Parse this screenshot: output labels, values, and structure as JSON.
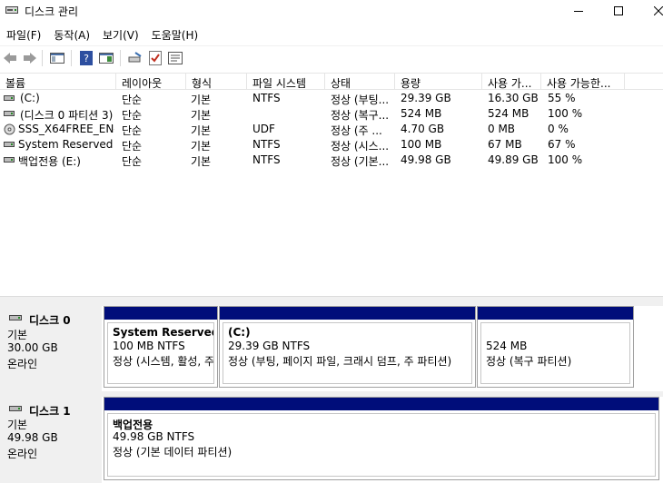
{
  "window": {
    "title": "디스크 관리"
  },
  "menu": [
    "파일(F)",
    "동작(A)",
    "보기(V)",
    "도움말(H)"
  ],
  "columns": [
    "볼륨",
    "레이아웃",
    "형식",
    "파일 시스템",
    "상태",
    "용량",
    "사용 가...",
    "사용 가능한..."
  ],
  "volumes": [
    {
      "name": "(C:)",
      "layout": "단순",
      "type": "기본",
      "fs": "NTFS",
      "status": "정상 (부팅...",
      "capacity": "29.39 GB",
      "free": "16.30 GB",
      "pct": "55 %",
      "icon": "drive-icon"
    },
    {
      "name": "(디스크 0 파티션 3)",
      "layout": "단순",
      "type": "기본",
      "fs": "",
      "status": "정상 (복구...",
      "capacity": "524 MB",
      "free": "524 MB",
      "pct": "100 %",
      "icon": "drive-icon"
    },
    {
      "name": "SSS_X64FREE_EN-...",
      "layout": "단순",
      "type": "기본",
      "fs": "UDF",
      "status": "정상 (주 ...",
      "capacity": "4.70 GB",
      "free": "0 MB",
      "pct": "0 %",
      "icon": "cd-drive-icon"
    },
    {
      "name": "System Reserved",
      "layout": "단순",
      "type": "기본",
      "fs": "NTFS",
      "status": "정상 (시스...",
      "capacity": "100 MB",
      "free": "67 MB",
      "pct": "67 %",
      "icon": "drive-icon"
    },
    {
      "name": "백업전용 (E:)",
      "layout": "단순",
      "type": "기본",
      "fs": "NTFS",
      "status": "정상 (기본...",
      "capacity": "49.98 GB",
      "free": "49.89 GB",
      "pct": "100 %",
      "icon": "drive-icon"
    }
  ],
  "disks": [
    {
      "name": "디스크 0",
      "type": "기본",
      "size": "30.00 GB",
      "state": "온라인",
      "partitions": [
        {
          "title": "System Reserved",
          "size": "100 MB NTFS",
          "status": "정상 (시스템, 활성, 주 파티션)"
        },
        {
          "title": "(C:)",
          "size": "29.39 GB NTFS",
          "status": "정상 (부팅, 페이지 파일, 크래시 덤프, 주 파티션)"
        },
        {
          "title": "",
          "size": "524 MB",
          "status": "정상 (복구 파티션)"
        }
      ]
    },
    {
      "name": "디스크 1",
      "type": "기본",
      "size": "49.98 GB",
      "state": "온라인",
      "partitions": [
        {
          "title": "백업전용",
          "size": "49.98 GB NTFS",
          "status": "정상 (기본 데이터 파티션)"
        }
      ]
    }
  ],
  "colors": {
    "partition_bar": "#000d7a",
    "lower_bg": "#f0f0f0"
  }
}
